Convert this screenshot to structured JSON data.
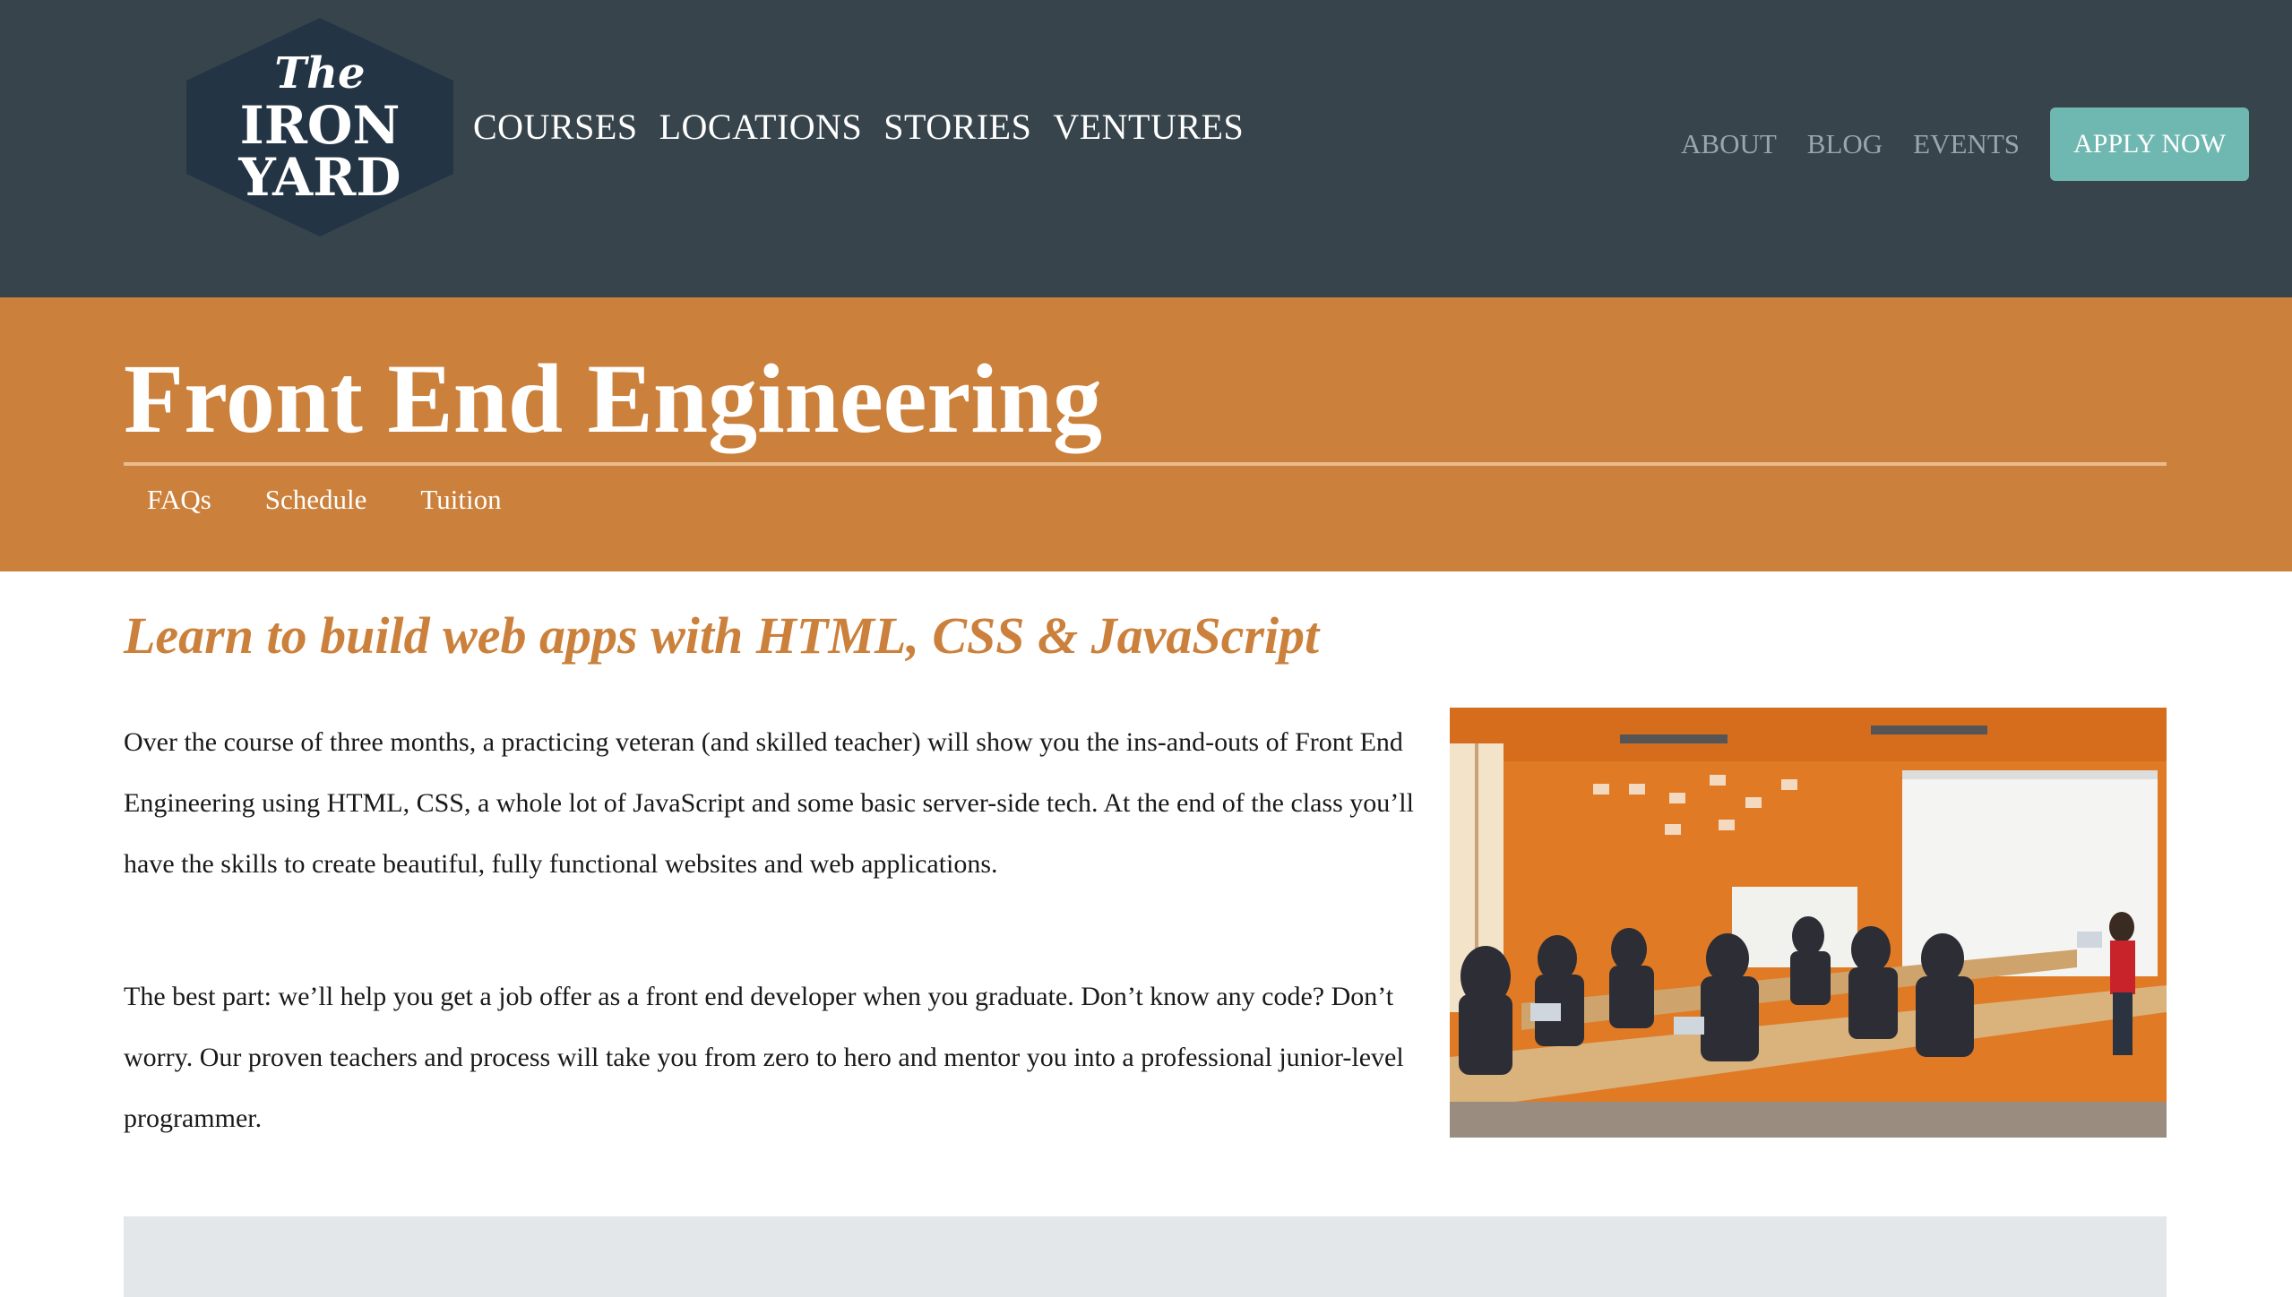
{
  "header": {
    "logo": {
      "line1": "The",
      "line2": "IRON",
      "line3": "YARD",
      "icon": "iron-yard-logo"
    },
    "main_nav": [
      "COURSES",
      "LOCATIONS",
      "STORIES",
      "VENTURES"
    ],
    "secondary_nav": [
      "ABOUT",
      "BLOG",
      "EVENTS"
    ],
    "apply_label": "APPLY NOW",
    "colors": {
      "header_bg": "#37444b",
      "apply_bg": "#6fb7b1"
    }
  },
  "course": {
    "title": "Front End Engineering",
    "sub_nav": [
      "FAQs",
      "Schedule",
      "Tuition"
    ],
    "band_color": "#cb803b"
  },
  "content": {
    "tagline": "Learn to build web apps with HTML, CSS & JavaScript",
    "paragraphs": [
      "Over the course of three months, a practicing veteran (and skilled teacher) will show you the ins-and-outs of Front End Engineering using HTML, CSS, a whole lot of JavaScript and some basic server-side tech. At the end of the class you’ll have the skills to create beautiful, fully functional websites and web applications.",
      "The best part: we’ll help you get a job offer as a front end developer when you graduate. Don’t know any code? Don’t worry. Our proven teachers and process will take you from zero to hero and mentor you into a professional junior-level programmer."
    ],
    "photo_icon": "classroom-photo"
  }
}
